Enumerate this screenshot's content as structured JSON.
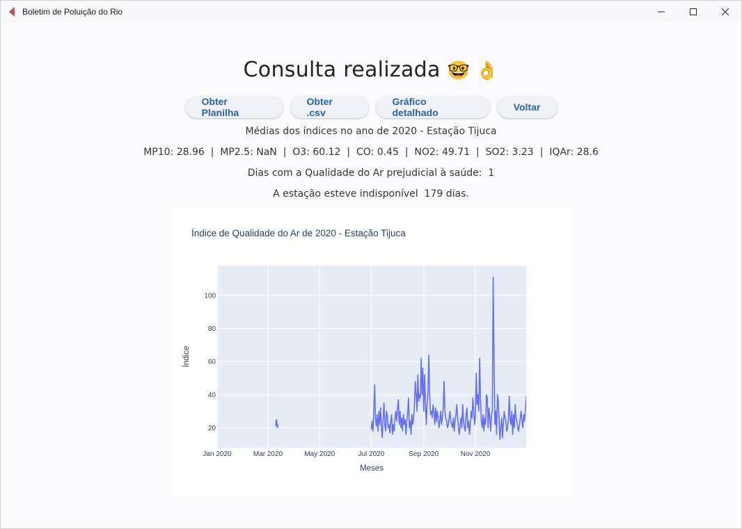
{
  "window": {
    "title": "Boletim de Poluição do Rio",
    "icon": "app-logo-icon",
    "controls": [
      "minimize-icon",
      "maximize-icon",
      "close-icon"
    ]
  },
  "page": {
    "heading": "Consulta realizada",
    "heading_emojis": "🤓 👌",
    "buttons": {
      "planilha": "Obter Planilha",
      "csv": "Obter .csv",
      "grafico": "Gráfico detalhado",
      "voltar": "Voltar"
    },
    "averages_title": "Médias dos índices no ano de 2020 - Estação Tijuca",
    "averages_line": "MP10: 28.96  |  MP2.5: NaN  |  O3: 60.12  |  CO: 0.45  |  NO2: 49.71  |  SO2: 3.23  |  IQAr: 28.6",
    "bad_days": "Dias com a Qualidade do Ar prejudicial à saúde:  1",
    "unavailable": "A estação esteve indisponível  179 dias."
  },
  "colors": {
    "button_text": "#2b63a3",
    "plot_bg": "#e5ecf6",
    "line": "#636efa"
  },
  "chart_data": {
    "type": "line",
    "title": "Índice de Qualidade do Ar de 2020 - Estação Tijuca",
    "xlabel": "Meses",
    "ylabel": "Índice",
    "x_ticks": [
      "Jan 2020",
      "Mar 2020",
      "May 2020",
      "Jul 2020",
      "Sep 2020",
      "Nov 2020"
    ],
    "y_ticks": [
      20,
      40,
      60,
      80,
      100
    ],
    "ylim": [
      8,
      118
    ],
    "xlim": [
      "2020-01-01",
      "2020-12-31"
    ],
    "grid": true,
    "series": [
      {
        "segments": [
          {
            "dates": [
              "2020-03-10",
              "2020-03-11",
              "2020-03-12",
              "2020-03-13"
            ],
            "values": [
              21,
              25,
              20,
              22
            ]
          },
          {
            "dates": [
              "2020-07-01",
              "2020-07-02",
              "2020-07-03",
              "2020-07-04",
              "2020-07-05",
              "2020-07-06",
              "2020-07-07",
              "2020-07-08",
              "2020-07-09",
              "2020-07-10",
              "2020-07-11",
              "2020-07-12",
              "2020-07-13",
              "2020-07-14",
              "2020-07-15",
              "2020-07-16",
              "2020-07-17",
              "2020-07-18",
              "2020-07-19",
              "2020-07-20",
              "2020-07-21",
              "2020-07-22",
              "2020-07-23",
              "2020-07-24",
              "2020-07-25",
              "2020-07-26",
              "2020-07-27",
              "2020-07-28",
              "2020-07-29",
              "2020-07-30",
              "2020-07-31",
              "2020-08-01",
              "2020-08-02",
              "2020-08-03",
              "2020-08-04",
              "2020-08-05",
              "2020-08-06",
              "2020-08-07",
              "2020-08-08",
              "2020-08-09",
              "2020-08-10",
              "2020-08-11",
              "2020-08-12",
              "2020-08-13",
              "2020-08-14",
              "2020-08-15",
              "2020-08-16",
              "2020-08-17",
              "2020-08-18",
              "2020-08-19",
              "2020-08-20",
              "2020-08-21",
              "2020-08-22",
              "2020-08-23",
              "2020-08-24",
              "2020-08-25",
              "2020-08-26",
              "2020-08-27",
              "2020-08-28",
              "2020-08-29",
              "2020-08-30",
              "2020-08-31",
              "2020-09-01",
              "2020-09-02",
              "2020-09-03",
              "2020-09-04",
              "2020-09-05",
              "2020-09-06",
              "2020-09-07",
              "2020-09-08",
              "2020-09-09",
              "2020-09-10",
              "2020-09-11",
              "2020-09-12",
              "2020-09-13",
              "2020-09-14",
              "2020-09-15",
              "2020-09-16",
              "2020-09-17",
              "2020-09-18",
              "2020-09-19",
              "2020-09-20",
              "2020-09-21",
              "2020-09-22",
              "2020-09-23",
              "2020-09-24",
              "2020-09-25",
              "2020-09-26",
              "2020-09-27",
              "2020-09-28",
              "2020-09-29",
              "2020-09-30",
              "2020-10-01",
              "2020-10-02",
              "2020-10-03",
              "2020-10-04",
              "2020-10-05",
              "2020-10-06",
              "2020-10-07",
              "2020-10-08",
              "2020-10-09",
              "2020-10-10",
              "2020-10-11",
              "2020-10-12",
              "2020-10-13",
              "2020-10-14",
              "2020-10-15",
              "2020-10-16",
              "2020-10-17",
              "2020-10-18",
              "2020-10-19",
              "2020-10-20",
              "2020-10-21",
              "2020-10-22",
              "2020-10-23",
              "2020-10-24",
              "2020-10-25",
              "2020-10-26",
              "2020-10-27",
              "2020-10-28",
              "2020-10-29",
              "2020-10-30",
              "2020-10-31",
              "2020-11-01",
              "2020-11-02",
              "2020-11-03",
              "2020-11-04",
              "2020-11-05",
              "2020-11-06",
              "2020-11-07",
              "2020-11-08",
              "2020-11-09",
              "2020-11-10",
              "2020-11-11",
              "2020-11-12",
              "2020-11-13",
              "2020-11-14",
              "2020-11-15",
              "2020-11-16",
              "2020-11-17",
              "2020-11-18",
              "2020-11-19",
              "2020-11-20",
              "2020-11-21",
              "2020-11-22",
              "2020-11-23",
              "2020-11-24",
              "2020-11-25",
              "2020-11-26",
              "2020-11-27",
              "2020-11-28",
              "2020-11-29",
              "2020-11-30",
              "2020-12-01",
              "2020-12-02",
              "2020-12-03",
              "2020-12-04",
              "2020-12-05",
              "2020-12-06",
              "2020-12-07",
              "2020-12-08",
              "2020-12-09",
              "2020-12-10",
              "2020-12-11",
              "2020-12-12",
              "2020-12-13",
              "2020-12-14",
              "2020-12-15",
              "2020-12-16",
              "2020-12-17",
              "2020-12-18",
              "2020-12-19",
              "2020-12-20",
              "2020-12-21",
              "2020-12-22",
              "2020-12-23",
              "2020-12-24",
              "2020-12-25",
              "2020-12-26",
              "2020-12-27",
              "2020-12-28",
              "2020-12-29",
              "2020-12-30",
              "2020-12-31"
            ],
            "values": [
              19,
              24,
              18,
              30,
              46,
              25,
              21,
              28,
              18,
              30,
              22,
              32,
              20,
              14,
              26,
              35,
              22,
              18,
              30,
              27,
              20,
              22,
              17,
              24,
              28,
              16,
              22,
              18,
              26,
              30,
              24,
              32,
              37,
              22,
              30,
              20,
              26,
              18,
              28,
              22,
              25,
              16,
              24,
              29,
              38,
              20,
              24,
              16,
              28,
              22,
              26,
              34,
              48,
              40,
              30,
              52,
              36,
              40,
              38,
              62,
              40,
              56,
              30,
              52,
              36,
              22,
              34,
              42,
              64,
              40,
              28,
              30,
              26,
              34,
              30,
              22,
              32,
              24,
              30,
              26,
              20,
              24,
              30,
              22,
              26,
              32,
              48,
              30,
              26,
              24,
              20,
              22,
              26,
              30,
              24,
              22,
              20,
              26,
              18,
              24,
              28,
              34,
              26,
              20,
              16,
              22,
              26,
              20,
              34,
              24,
              20,
              18,
              28,
              32,
              20,
              24,
              16,
              22,
              30,
              26,
              38,
              30,
              22,
              28,
              53,
              34,
              40,
              30,
              62,
              38,
              24,
              20,
              28,
              18,
              26,
              22,
              40,
              38,
              20,
              32,
              26,
              18,
              28,
              30,
              111,
              60,
              22,
              30,
              16,
              40,
              36,
              24,
              13,
              20,
              26,
              14,
              22,
              30,
              26,
              24,
              18,
              20,
              26,
              39,
              24,
              22,
              30,
              16,
              28,
              20,
              34,
              26,
              24,
              20,
              18,
              22,
              26,
              30,
              24,
              20,
              28,
              24,
              30,
              39
            ]
          }
        ]
      }
    ]
  }
}
